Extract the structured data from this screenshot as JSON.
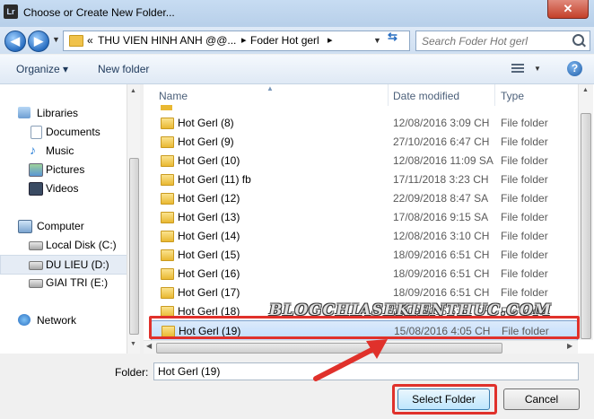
{
  "window": {
    "app_icon": "Lr",
    "title": "Choose or Create New Folder...",
    "close_glyph": "✕"
  },
  "address": {
    "prefix": "«",
    "crumbs": [
      "THU VIEN HINH ANH @@...",
      "Foder Hot gerl"
    ],
    "separator": "▸",
    "search_placeholder": "Search Foder Hot gerl"
  },
  "toolbar": {
    "organize_label": "Organize ▾",
    "new_folder_label": "New folder",
    "help_glyph": "?"
  },
  "nav": {
    "items": [
      {
        "label": "Libraries",
        "icon": "libraries-icon"
      },
      {
        "label": "Documents",
        "icon": "documents-icon"
      },
      {
        "label": "Music",
        "icon": "music-icon"
      },
      {
        "label": "Pictures",
        "icon": "pictures-icon"
      },
      {
        "label": "Videos",
        "icon": "videos-icon"
      },
      {
        "label": "Computer",
        "icon": "computer-icon"
      },
      {
        "label": "Local Disk (C:)",
        "icon": "drive-icon"
      },
      {
        "label": "DU LIEU (D:)",
        "icon": "drive-icon"
      },
      {
        "label": "GIAI TRI (E:)",
        "icon": "drive-icon"
      },
      {
        "label": "Network",
        "icon": "network-icon"
      }
    ]
  },
  "columns": {
    "name": "Name",
    "date": "Date modified",
    "type": "Type"
  },
  "files": [
    {
      "name": "Hot Gerl (8)",
      "date": "12/08/2016 3:09 CH",
      "type": "File folder"
    },
    {
      "name": "Hot Gerl (9)",
      "date": "27/10/2016 6:47 CH",
      "type": "File folder"
    },
    {
      "name": "Hot Gerl (10)",
      "date": "12/08/2016 11:09 SA",
      "type": "File folder"
    },
    {
      "name": "Hot Gerl (11) fb",
      "date": "17/11/2018 3:23 CH",
      "type": "File folder"
    },
    {
      "name": "Hot Gerl (12)",
      "date": "22/09/2018 8:47 SA",
      "type": "File folder"
    },
    {
      "name": "Hot Gerl (13)",
      "date": "17/08/2016 9:15 SA",
      "type": "File folder"
    },
    {
      "name": "Hot Gerl (14)",
      "date": "12/08/2016 3:10 CH",
      "type": "File folder"
    },
    {
      "name": "Hot Gerl (15)",
      "date": "18/09/2016 6:51 CH",
      "type": "File folder"
    },
    {
      "name": "Hot Gerl (16)",
      "date": "18/09/2016 6:51 CH",
      "type": "File folder"
    },
    {
      "name": "Hot Gerl (17)",
      "date": "18/09/2016 6:51 CH",
      "type": "File folder"
    },
    {
      "name": "Hot Gerl (18)",
      "date": "18/09/2016 6:51 CH",
      "type": "File folder"
    },
    {
      "name": "Hot Gerl (19)",
      "date": "15/08/2016 4:05 CH",
      "type": "File folder"
    }
  ],
  "watermark": "BLOGCHIASEKIENTHUC.COM",
  "footer": {
    "folder_label": "Folder:",
    "folder_value": "Hot Gerl (19)",
    "select_label": "Select Folder",
    "cancel_label": "Cancel"
  },
  "colors": {
    "highlight": "#e0312b",
    "selection": "#c1dcfc"
  }
}
